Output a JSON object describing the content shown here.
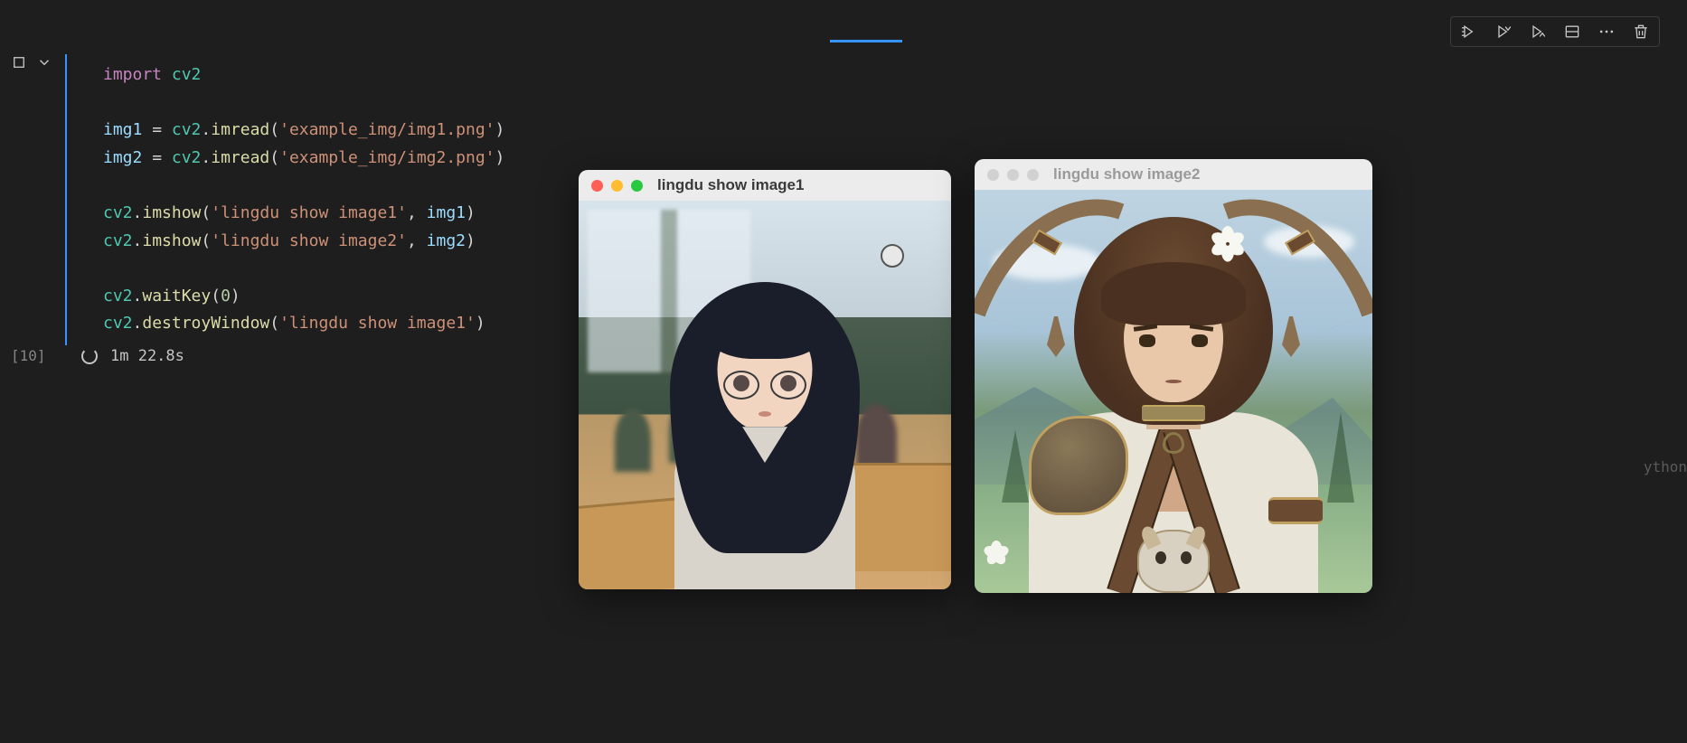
{
  "cell": {
    "exec_label": "[10]",
    "exec_time": "1m 22.8s",
    "code": {
      "l1_import": "import",
      "l1_cv2": "cv2",
      "l2_var": "img1",
      "l2_eq": " = ",
      "l2_mod": "cv2",
      "l2_dot": ".",
      "l2_fn": "imread",
      "l2_open": "(",
      "l2_str": "'example_img/img1.png'",
      "l2_close": ")",
      "l3_var": "img2",
      "l3_str": "'example_img/img2.png'",
      "l4_mod": "cv2",
      "l4_fn": "imshow",
      "l4_str": "'lingdu show image1'",
      "l4_comma": ", ",
      "l4_arg": "img1",
      "l5_str": "'lingdu show image2'",
      "l5_arg": "img2",
      "l6_fn": "waitKey",
      "l6_num": "0",
      "l7_fn": "destroyWindow",
      "l7_str": "'lingdu show image1'"
    }
  },
  "windows": {
    "win1_title": "lingdu show image1",
    "win2_title": "lingdu show image2"
  },
  "footer_lang": "ython"
}
